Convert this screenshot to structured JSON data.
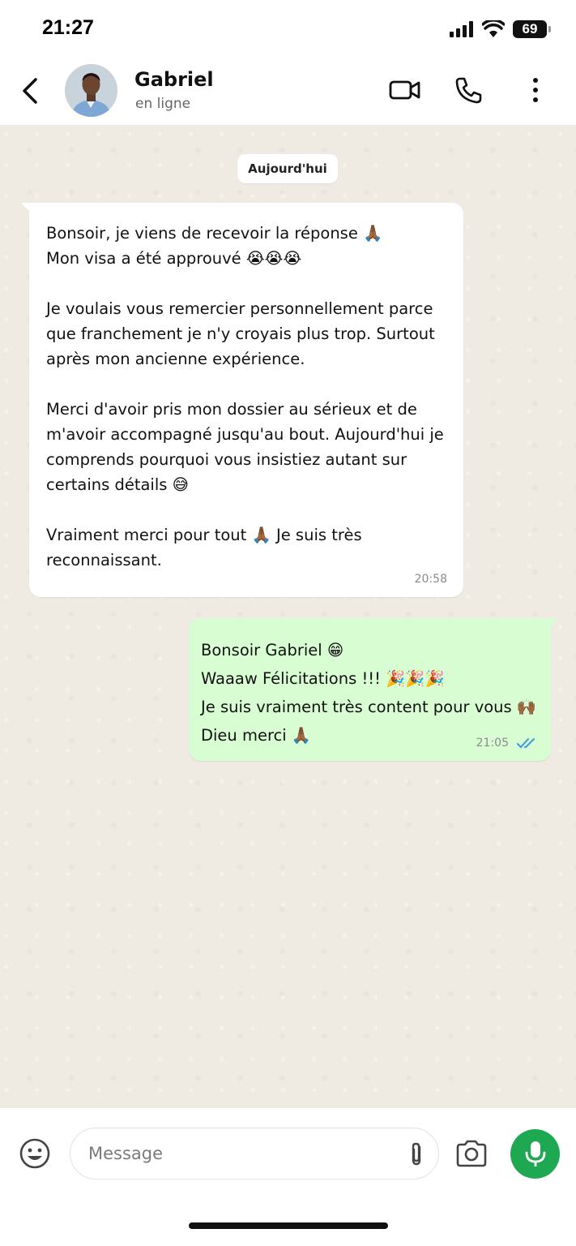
{
  "status_bar": {
    "time": "21:27",
    "battery": "69"
  },
  "header": {
    "contact_name": "Gabriel",
    "contact_status": "en ligne",
    "icons": [
      "back-icon",
      "video-call-icon",
      "phone-icon",
      "more-vert-icon"
    ]
  },
  "chat": {
    "date_chip": "Aujourd'hui",
    "messages": [
      {
        "direction": "incoming",
        "text": "Bonsoir, je viens de recevoir la réponse 🙏🏾\nMon visa a été approuvé 😭😭😭\n\nJe voulais vous remercier personnellement parce que franchement je n'y croyais plus trop. Surtout après mon ancienne expérience.\n\nMerci d'avoir pris mon dossier au sérieux et de m'avoir accompagné jusqu'au bout. Aujourd'hui je comprends pourquoi vous insistiez autant sur certains détails 😅\n\nVraiment merci pour tout 🙏🏾 Je suis très reconnaissant.",
        "time": "20:58"
      },
      {
        "direction": "outgoing",
        "text": "Bonsoir Gabriel 😁\nWaaaw Félicitations !!! 🎉🎉🎉\nJe suis vraiment très content pour vous 🙌🏾\nDieu merci 🙏🏾",
        "time": "21:05",
        "status": "read"
      }
    ]
  },
  "input_bar": {
    "placeholder": "Message",
    "icons": [
      "emoji-icon",
      "attach-icon",
      "camera-icon",
      "mic-icon"
    ],
    "mic_color": "#1da851"
  },
  "colors": {
    "outgoing_bubble": "#d9fdd3",
    "chat_background": "#efeae2",
    "read_ticks": "#3a9bd9"
  }
}
